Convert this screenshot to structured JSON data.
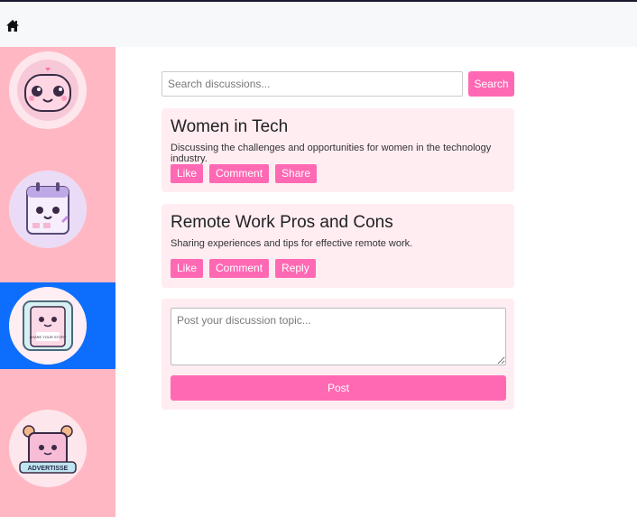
{
  "nav": {
    "home_icon": "home-icon"
  },
  "sidebar": {
    "items": [
      {
        "name": "mascot-face-icon",
        "active": false
      },
      {
        "name": "calendar-icon",
        "active": false
      },
      {
        "name": "share-your-story-icon",
        "active": true,
        "badge_text": "SHARE YOUR STORY"
      },
      {
        "name": "advertise-icon",
        "active": false,
        "badge_text": "ADVERTISSE"
      }
    ],
    "active_color": "#0d6efd",
    "background_color": "#ffb8c3"
  },
  "search": {
    "placeholder": "Search discussions...",
    "button_label": "Search"
  },
  "discussions": [
    {
      "title": "Women in Tech",
      "description": "Discussing the challenges and opportunities for women in the technology industry.",
      "actions": [
        "Like",
        "Comment",
        "Share"
      ]
    },
    {
      "title": "Remote Work Pros and Cons",
      "description": "Sharing experiences and tips for effective remote work.",
      "actions": [
        "Like",
        "Comment",
        "Reply"
      ]
    }
  ],
  "post_form": {
    "placeholder": "Post your discussion topic...",
    "button_label": "Post"
  },
  "colors": {
    "accent": "#ff69b4",
    "card_bg": "#ffedf2"
  }
}
